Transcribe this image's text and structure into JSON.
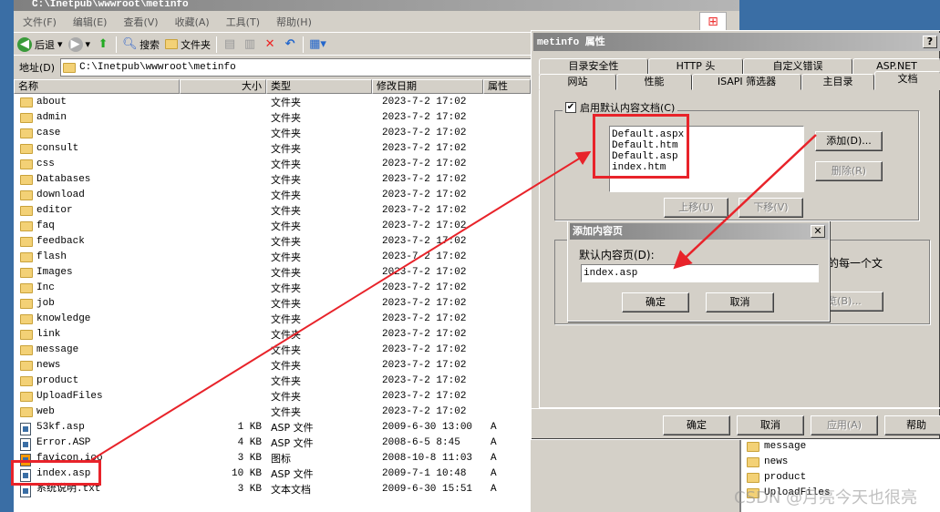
{
  "explorer": {
    "title": "C:\\Inetpub\\wwwroot\\metinfo",
    "menu": [
      "文件(F)",
      "编辑(E)",
      "查看(V)",
      "收藏(A)",
      "工具(T)",
      "帮助(H)"
    ],
    "toolbar": {
      "back": "后退",
      "search": "搜索",
      "folders": "文件夹"
    },
    "address_label": "地址(D)",
    "address": "C:\\Inetpub\\wwwroot\\metinfo",
    "columns": [
      "名称",
      "大小",
      "类型",
      "修改日期",
      "属性"
    ],
    "rows": [
      {
        "name": "about",
        "size": "",
        "type": "文件夹",
        "date": "2023-7-2 17:02",
        "attr": "",
        "kind": "folder"
      },
      {
        "name": "admin",
        "size": "",
        "type": "文件夹",
        "date": "2023-7-2 17:02",
        "attr": "",
        "kind": "folder"
      },
      {
        "name": "case",
        "size": "",
        "type": "文件夹",
        "date": "2023-7-2 17:02",
        "attr": "",
        "kind": "folder"
      },
      {
        "name": "consult",
        "size": "",
        "type": "文件夹",
        "date": "2023-7-2 17:02",
        "attr": "",
        "kind": "folder"
      },
      {
        "name": "css",
        "size": "",
        "type": "文件夹",
        "date": "2023-7-2 17:02",
        "attr": "",
        "kind": "folder"
      },
      {
        "name": "Databases",
        "size": "",
        "type": "文件夹",
        "date": "2023-7-2 17:02",
        "attr": "",
        "kind": "folder"
      },
      {
        "name": "download",
        "size": "",
        "type": "文件夹",
        "date": "2023-7-2 17:02",
        "attr": "",
        "kind": "folder"
      },
      {
        "name": "editor",
        "size": "",
        "type": "文件夹",
        "date": "2023-7-2 17:02",
        "attr": "",
        "kind": "folder"
      },
      {
        "name": "faq",
        "size": "",
        "type": "文件夹",
        "date": "2023-7-2 17:02",
        "attr": "",
        "kind": "folder"
      },
      {
        "name": "feedback",
        "size": "",
        "type": "文件夹",
        "date": "2023-7-2 17:02",
        "attr": "",
        "kind": "folder"
      },
      {
        "name": "flash",
        "size": "",
        "type": "文件夹",
        "date": "2023-7-2 17:02",
        "attr": "",
        "kind": "folder"
      },
      {
        "name": "Images",
        "size": "",
        "type": "文件夹",
        "date": "2023-7-2 17:02",
        "attr": "",
        "kind": "folder"
      },
      {
        "name": "Inc",
        "size": "",
        "type": "文件夹",
        "date": "2023-7-2 17:02",
        "attr": "",
        "kind": "folder"
      },
      {
        "name": "job",
        "size": "",
        "type": "文件夹",
        "date": "2023-7-2 17:02",
        "attr": "",
        "kind": "folder"
      },
      {
        "name": "knowledge",
        "size": "",
        "type": "文件夹",
        "date": "2023-7-2 17:02",
        "attr": "",
        "kind": "folder"
      },
      {
        "name": "link",
        "size": "",
        "type": "文件夹",
        "date": "2023-7-2 17:02",
        "attr": "",
        "kind": "folder"
      },
      {
        "name": "message",
        "size": "",
        "type": "文件夹",
        "date": "2023-7-2 17:02",
        "attr": "",
        "kind": "folder"
      },
      {
        "name": "news",
        "size": "",
        "type": "文件夹",
        "date": "2023-7-2 17:02",
        "attr": "",
        "kind": "folder"
      },
      {
        "name": "product",
        "size": "",
        "type": "文件夹",
        "date": "2023-7-2 17:02",
        "attr": "",
        "kind": "folder"
      },
      {
        "name": "UploadFiles",
        "size": "",
        "type": "文件夹",
        "date": "2023-7-2 17:02",
        "attr": "",
        "kind": "folder"
      },
      {
        "name": "web",
        "size": "",
        "type": "文件夹",
        "date": "2023-7-2 17:02",
        "attr": "",
        "kind": "folder"
      },
      {
        "name": "53kf.asp",
        "size": "1 KB",
        "type": "ASP 文件",
        "date": "2009-6-30 13:00",
        "attr": "A",
        "kind": "file"
      },
      {
        "name": "Error.ASP",
        "size": "4 KB",
        "type": "ASP 文件",
        "date": "2008-6-5 8:45",
        "attr": "A",
        "kind": "file"
      },
      {
        "name": "favicon.ico",
        "size": "3 KB",
        "type": "图标",
        "date": "2008-10-8 11:03",
        "attr": "A",
        "kind": "ico"
      },
      {
        "name": "index.asp",
        "size": "10 KB",
        "type": "ASP 文件",
        "date": "2009-7-1 10:48",
        "attr": "A",
        "kind": "file"
      },
      {
        "name": "系统说明.txt",
        "size": "3 KB",
        "type": "文本文档",
        "date": "2009-6-30 15:51",
        "attr": "A",
        "kind": "txt"
      }
    ]
  },
  "props": {
    "title": "metinfo 属性",
    "help": "?",
    "tabs_row1": [
      "目录安全性",
      "HTTP 头",
      "自定义错误",
      "ASP.NET"
    ],
    "tabs_row2": [
      "网站",
      "性能",
      "ISAPI 筛选器",
      "主目录",
      "文档"
    ],
    "active_tab": "文档",
    "enable_default": "启用默认内容文档(C)",
    "enable_checked": true,
    "documents": [
      "Default.aspx",
      "Default.htm",
      "Default.asp",
      "index.htm"
    ],
    "add": "添加(D)...",
    "remove": "删除(R)",
    "move_up": "上移(U)",
    "move_down": "下移(V)",
    "footer_partial": "的每一个文",
    "browse_partial": "览(B)...",
    "ok": "确定",
    "cancel": "取消",
    "apply": "应用(A)",
    "helpbtn": "帮助"
  },
  "add_dialog": {
    "title": "添加内容页",
    "label": "默认内容页(D):",
    "value": "index.asp",
    "ok": "确定",
    "cancel": "取消",
    "close": "✕"
  },
  "background_list": [
    "message",
    "news",
    "product",
    "UploadFiles"
  ],
  "watermark": "CSDN @月亮今天也很亮",
  "colors": {
    "annotation": "#e8232a",
    "desktop": "#3a6ea5",
    "dialog": "#d4d0c8"
  }
}
